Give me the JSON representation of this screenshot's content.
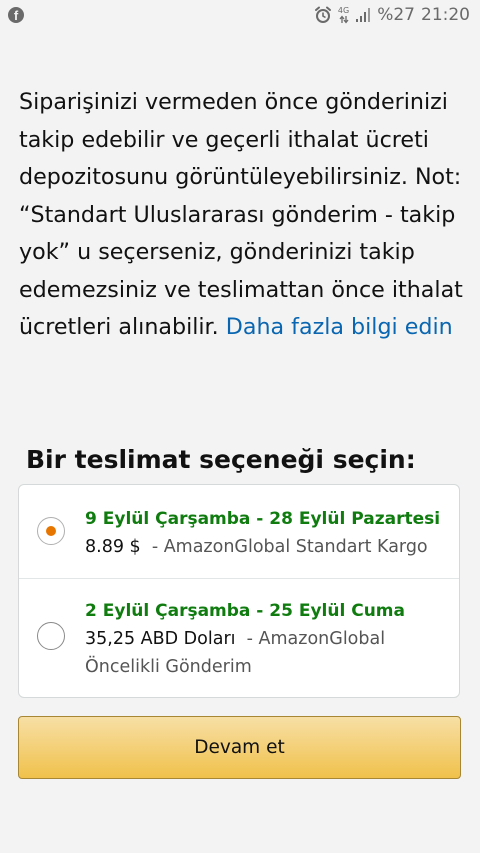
{
  "status_bar": {
    "app_icon": "facebook-icon",
    "alarm_icon": "alarm-clock-icon",
    "network": "4G",
    "signal_icon": "signal-bars-icon",
    "battery": "%27",
    "time": "21:20"
  },
  "info": {
    "text": "Siparişinizi vermeden önce gönderinizi takip edebilir ve geçerli ithalat ücreti depozitosunu görüntüleyebilirsiniz. Not: “Standart Uluslararası gönderim - takip yok” u seçerseniz, gönderinizi takip edemezsiniz ve teslimattan önce ithalat ücretleri alınabilir.",
    "link": "Daha fazla bilgi edin"
  },
  "delivery": {
    "title": "Bir teslimat seçeneği seçin:",
    "options": [
      {
        "date": "9 Eylül Çarşamba - 28 Eylül Pazartesi",
        "price": "8.89 $",
        "service": "- AmazonGlobal Standart Kargo",
        "selected": true
      },
      {
        "date": "2 Eylül Çarşamba - 25 Eylül Cuma",
        "price": "35,25 ABD Doları",
        "service": "- AmazonGlobal Öncelikli Gönderim",
        "selected": false
      }
    ]
  },
  "continue_button": "Devam et",
  "colors": {
    "accent_orange": "#e77600",
    "date_green": "#107c10",
    "link_blue": "#0a66b0",
    "button_yellow": "#f0c14b"
  }
}
